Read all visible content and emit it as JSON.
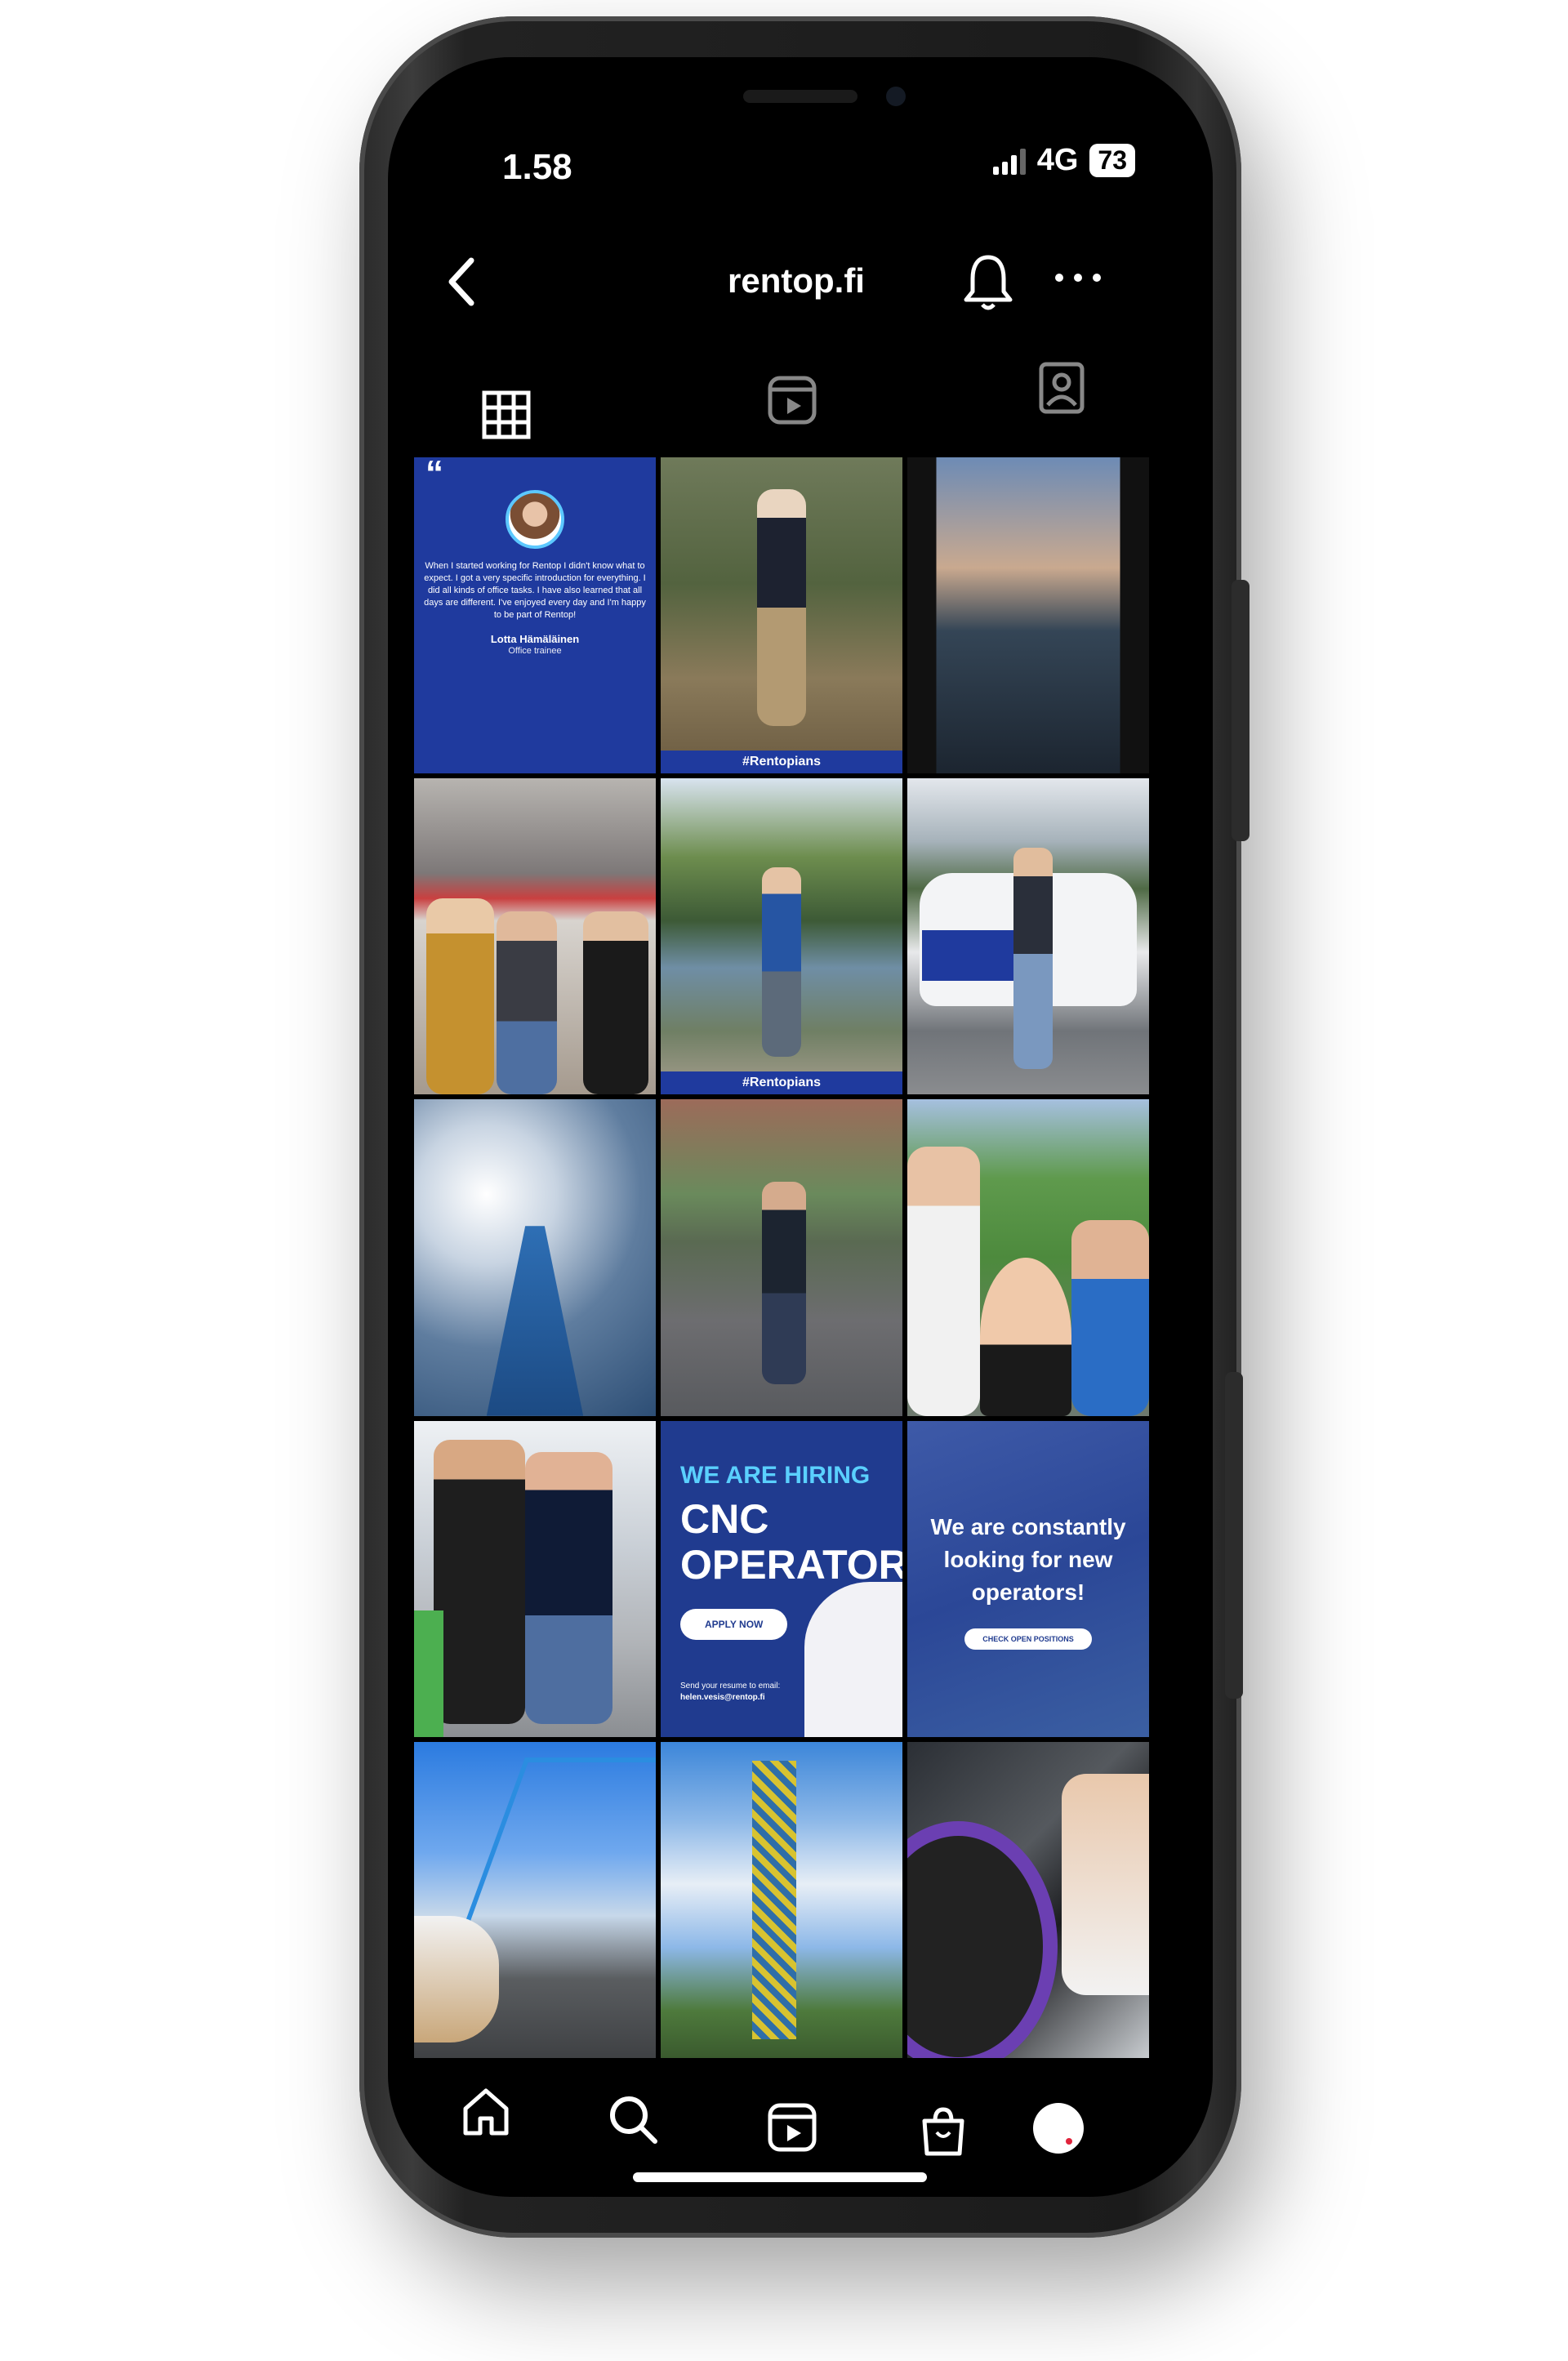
{
  "status_bar": {
    "time": "1.58",
    "network": "4G",
    "battery": "73"
  },
  "header": {
    "title": "rentop.fi"
  },
  "tabs": [
    {
      "name": "grid",
      "icon": "grid-icon"
    },
    {
      "name": "reels",
      "icon": "reels-icon"
    },
    {
      "name": "tagged",
      "icon": "tagged-icon"
    }
  ],
  "posts": {
    "quote": {
      "quote_mark": "“",
      "text": "When I started working for Rentop I didn't know what to expect. I got a very specific introduction for everything. I did all kinds of office tasks. I have also learned that all days are different. I've enjoyed every day and I'm happy to be part of Rentop!",
      "name": "Lotta Hämäläinen",
      "role": "Office trainee"
    },
    "tag_rentopians": "#Rentopians",
    "tag_rentopians_2": "#Rentopians",
    "hiring": {
      "top": "WE ARE HIRING",
      "line1": "CNC",
      "line2": "OPERATORS",
      "button": "APPLY NOW",
      "email_line1": "Send your resume to email:",
      "email_line2": "helen.vesis@rentop.fi"
    },
    "looking": {
      "text": "We are constantly looking for new operators!",
      "button": "CHECK OPEN POSITIONS"
    }
  },
  "bottom_nav": [
    {
      "name": "home",
      "icon": "home-icon"
    },
    {
      "name": "search",
      "icon": "search-icon"
    },
    {
      "name": "reels",
      "icon": "reels-icon"
    },
    {
      "name": "shop",
      "icon": "shop-icon"
    },
    {
      "name": "profile",
      "icon": "avatar"
    }
  ],
  "colors": {
    "brand_blue": "#1f3a9e",
    "accent_cyan": "#5ad0ff",
    "background": "#000000"
  }
}
